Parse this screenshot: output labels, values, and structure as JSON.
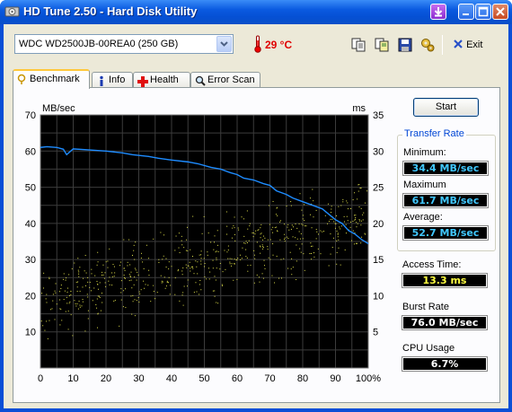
{
  "window": {
    "title": "HD Tune 2.50 - Hard Disk Utility",
    "controls": [
      "download-icon",
      "minimize-icon",
      "maximize-icon",
      "close-icon"
    ]
  },
  "toolbar": {
    "drive": "WDC WD2500JB-00REA0 (250 GB)",
    "temperature": "29 °C",
    "exit_label": "Exit",
    "icons": [
      "copy-text-icon",
      "copy-info-icon",
      "save-icon",
      "options-icon",
      "exit-icon"
    ]
  },
  "tabs": [
    {
      "label": "Benchmark",
      "icon": "benchmark-icon",
      "active": true
    },
    {
      "label": "Info",
      "icon": "info-icon",
      "active": false
    },
    {
      "label": "Health",
      "icon": "health-icon",
      "active": false
    },
    {
      "label": "Error Scan",
      "icon": "error-scan-icon",
      "active": false
    }
  ],
  "benchmark": {
    "start_label": "Start",
    "transfer_rate_title": "Transfer Rate",
    "minimum_label": "Minimum:",
    "minimum_value": "34.4 MB/sec",
    "maximum_label": "Maximum",
    "maximum_value": "61.7 MB/sec",
    "average_label": "Average:",
    "average_value": "52.7 MB/sec",
    "access_time_label": "Access Time:",
    "access_time_value": "13.3 ms",
    "burst_rate_label": "Burst Rate",
    "burst_rate_value": "76.0 MB/sec",
    "cpu_usage_label": "CPU Usage",
    "cpu_usage_value": "6.7%",
    "colors": {
      "transfer": "#1e8cff",
      "access": "#e0e04a",
      "value_blue": "#40c8ff",
      "value_yellow": "#ffff40",
      "value_white": "#ffffff"
    }
  },
  "chart_data": {
    "type": "line",
    "ylabel_left": "MB/sec",
    "ylabel_right": "ms",
    "x_ticks": [
      "0",
      "10",
      "20",
      "30",
      "40",
      "50",
      "60",
      "70",
      "80",
      "90",
      "100%"
    ],
    "y_left_ticks": [
      "70",
      "60",
      "50",
      "40",
      "30",
      "20",
      "10"
    ],
    "y_right_ticks": [
      "35",
      "30",
      "25",
      "20",
      "15",
      "10",
      "5"
    ],
    "xlim": [
      0,
      100
    ],
    "ylim_left": [
      0,
      70
    ],
    "ylim_right": [
      0,
      35
    ],
    "grid": true,
    "series": [
      {
        "name": "Transfer Rate",
        "axis": "left",
        "x": [
          0,
          2,
          5,
          7,
          8,
          10,
          15,
          20,
          25,
          28,
          33,
          36,
          40,
          45,
          48,
          52,
          55,
          58,
          60,
          62,
          65,
          68,
          70,
          72,
          75,
          77,
          80,
          83,
          86,
          88,
          90,
          92,
          94,
          96,
          98,
          100
        ],
        "y": [
          61,
          61.2,
          61,
          60.5,
          59,
          60.6,
          60.3,
          60,
          59.5,
          59,
          58.5,
          58,
          57.5,
          57,
          56.5,
          55.5,
          55,
          54,
          53.5,
          52.5,
          52,
          51,
          50.5,
          49,
          48,
          47,
          46,
          45,
          44,
          42.5,
          41,
          40,
          38,
          37,
          35.5,
          34.4
        ]
      },
      {
        "name": "Access Time",
        "axis": "right",
        "type": "scatter",
        "x_min": 0,
        "x_max": 100,
        "y_center_start": 9,
        "y_center_end": 21,
        "y_spread": 5
      }
    ]
  }
}
